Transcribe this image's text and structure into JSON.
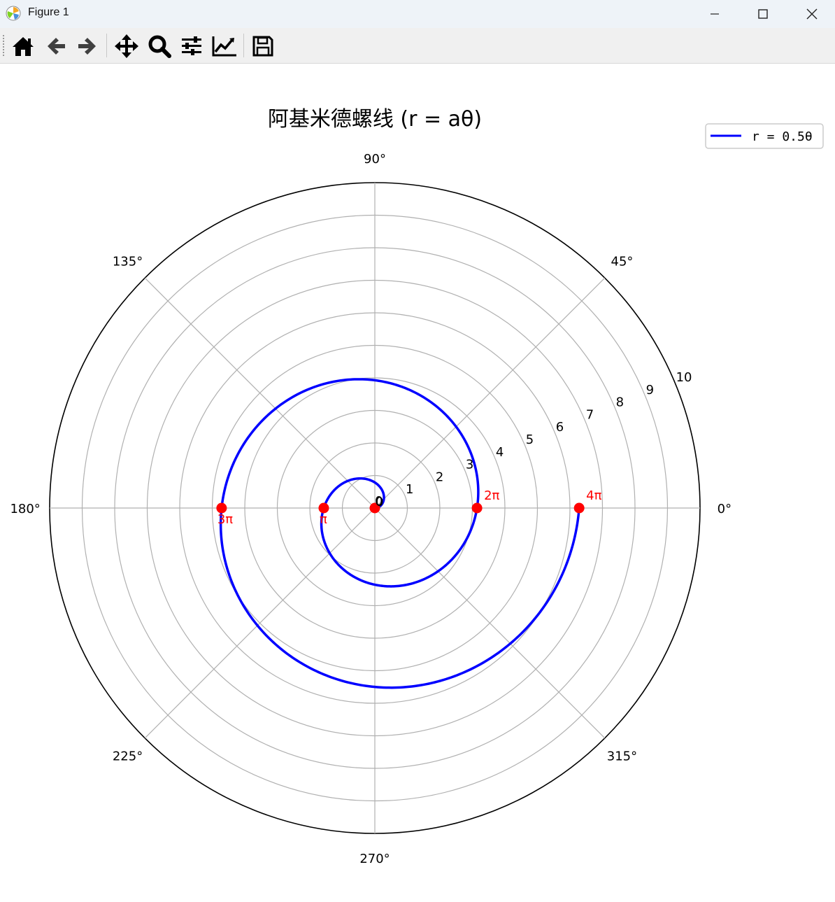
{
  "window": {
    "title": "Figure 1",
    "controls": [
      "minimize",
      "maximize",
      "close"
    ]
  },
  "toolbar": {
    "tools": [
      {
        "name": "home-icon",
        "tooltip": "Reset original view"
      },
      {
        "name": "back-arrow-icon",
        "tooltip": "Back to previous view"
      },
      {
        "name": "forward-arrow-icon",
        "tooltip": "Forward to next view"
      },
      {
        "name": "pan-icon",
        "tooltip": "Pan axes"
      },
      {
        "name": "zoom-icon",
        "tooltip": "Zoom to rectangle"
      },
      {
        "name": "subplots-icon",
        "tooltip": "Configure subplots"
      },
      {
        "name": "axes-edit-icon",
        "tooltip": "Edit axis"
      },
      {
        "name": "save-icon",
        "tooltip": "Save the figure"
      }
    ]
  },
  "chart_data": {
    "type": "line",
    "projection": "polar",
    "title": "阿基米德螺线 (r = aθ)",
    "a": 0.5,
    "theta_range": [
      0,
      "4π"
    ],
    "series": [
      {
        "name": "r = 0.5θ",
        "color": "#0000ff",
        "equation": "r = 0.5θ"
      }
    ],
    "theta_ticks": [
      "0°",
      "45°",
      "90°",
      "135°",
      "180°",
      "225°",
      "270°",
      "315°"
    ],
    "r_ticks": [
      "0",
      "1",
      "2",
      "3",
      "4",
      "5",
      "6",
      "7",
      "8",
      "9",
      "10"
    ],
    "rlim": [
      0,
      10
    ],
    "grid": true,
    "legend_position": "top-right",
    "marked_points": [
      {
        "theta": 0,
        "label": "0"
      },
      {
        "theta": 3.14159,
        "label": "π"
      },
      {
        "theta": 6.28319,
        "label": "2π"
      },
      {
        "theta": 9.42478,
        "label": "3π"
      },
      {
        "theta": 12.56637,
        "label": "4π"
      }
    ],
    "marker_color": "#ff0000"
  }
}
